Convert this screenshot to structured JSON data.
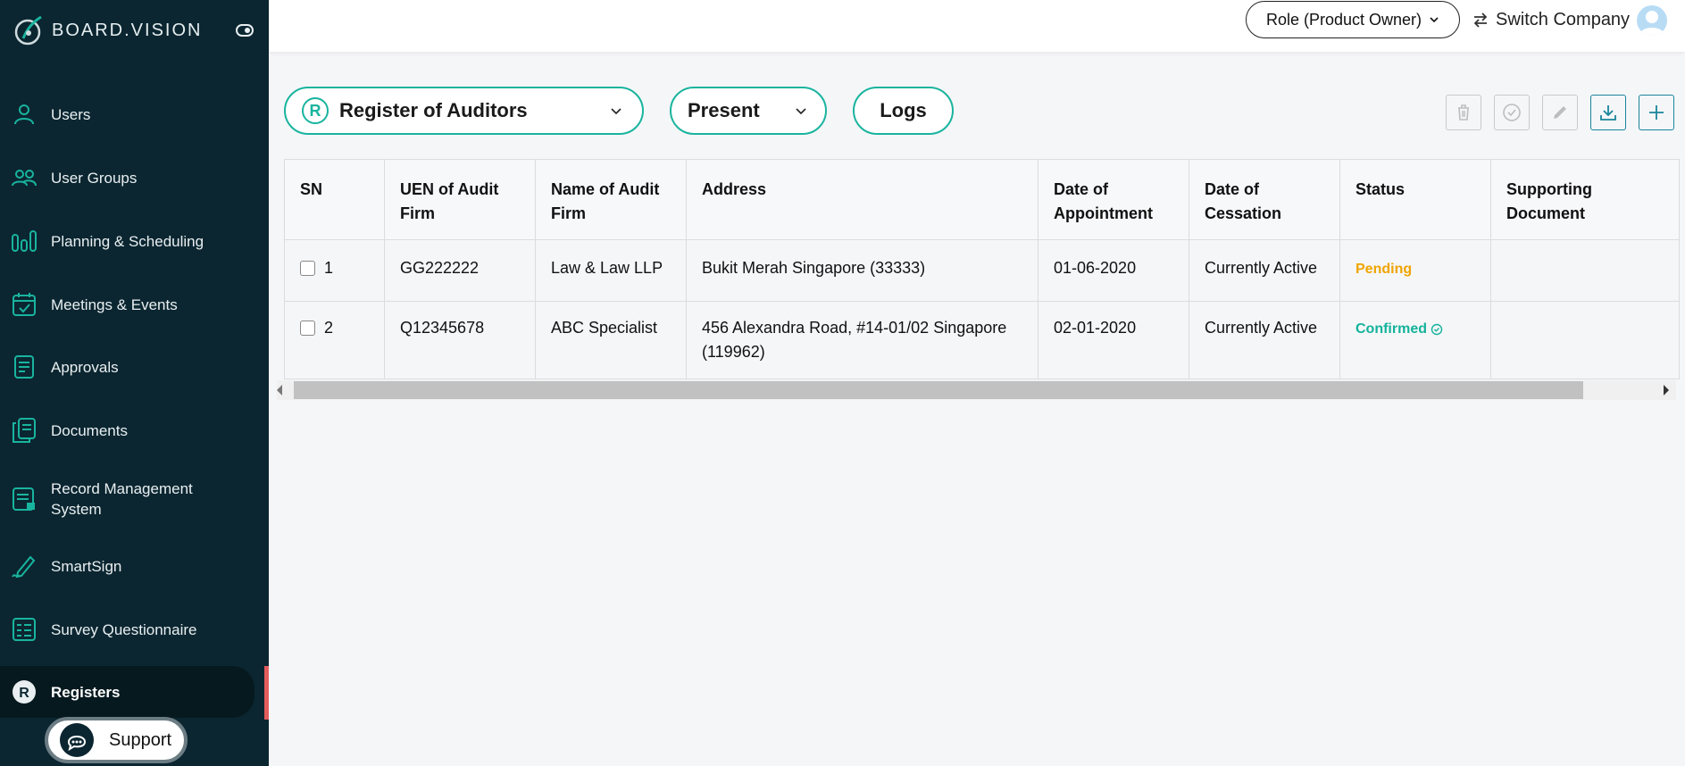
{
  "app": {
    "logo_text": "BOARD.VISION"
  },
  "sidebar": {
    "items": [
      {
        "label": "Users",
        "icon": "user-icon"
      },
      {
        "label": "User Groups",
        "icon": "user-group-icon"
      },
      {
        "label": "Planning & Scheduling",
        "icon": "planning-icon"
      },
      {
        "label": "Meetings & Events",
        "icon": "calendar-icon"
      },
      {
        "label": "Approvals",
        "icon": "approvals-icon"
      },
      {
        "label": "Documents",
        "icon": "documents-icon"
      },
      {
        "label": "Record Management System",
        "icon": "record-icon"
      },
      {
        "label": "SmartSign",
        "icon": "pen-icon"
      },
      {
        "label": "Survey Questionnaire",
        "icon": "survey-icon"
      },
      {
        "label": "Registers",
        "icon": "registers-icon",
        "active": true
      }
    ],
    "support_label": "Support"
  },
  "topbar": {
    "role_label": "Role (Product Owner)",
    "switch_label": "Switch Company"
  },
  "filters": {
    "register_badge": "R",
    "register_label": "Register of Auditors",
    "period_label": "Present",
    "logs_label": "Logs"
  },
  "toolbar": {
    "buttons": [
      "delete-icon",
      "approve-icon",
      "edit-icon",
      "download-icon",
      "add-icon"
    ]
  },
  "table": {
    "headers": [
      "SN",
      "UEN of Audit Firm",
      "Name of Audit Firm",
      "Address",
      "Date of Appointment",
      "Date of Cessation",
      "Status",
      "Supporting Document"
    ],
    "rows": [
      {
        "sn": "1",
        "uen": "GG222222",
        "name": "Law & Law LLP",
        "address": "Bukit Merah Singapore (33333)",
        "appointment": "01-06-2020",
        "cessation": "Currently Active",
        "status": "Pending",
        "doc": ""
      },
      {
        "sn": "2",
        "uen": "Q12345678",
        "name": "ABC Specialist",
        "address": "456 Alexandra Road, #14-01/02 Singapore (119962)",
        "appointment": "02-01-2020",
        "cessation": "Currently Active",
        "status": "Confirmed",
        "doc": ""
      }
    ]
  },
  "colors": {
    "sidebar_bg": "#0b2631",
    "accent": "#19b49e",
    "pending": "#f0a500",
    "confirmed": "#13b39b",
    "active_marker": "#e35d5d"
  }
}
